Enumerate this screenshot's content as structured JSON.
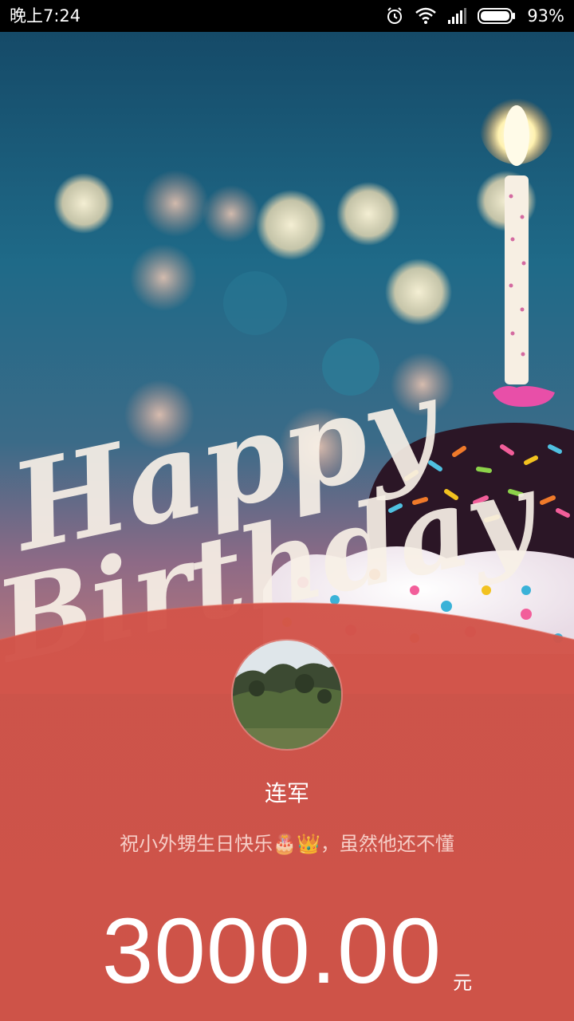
{
  "status_bar": {
    "time": "晚上7:24",
    "battery_percent": "93%",
    "icons": [
      "alarm-icon",
      "wifi-icon",
      "signal-icon",
      "battery-icon"
    ]
  },
  "hero": {
    "image": "happy-birthday-cupcake-with-candle",
    "lettering": "Happy Birthday"
  },
  "red_packet": {
    "sender_name": "连军",
    "greeting": "祝小外甥生日快乐🎂👑，虽然他还不懂",
    "amount": "3000.00",
    "currency_unit": "元"
  },
  "colors": {
    "card_red": "#d9564a",
    "status_bar": "#000000",
    "text_white": "#ffffff"
  }
}
